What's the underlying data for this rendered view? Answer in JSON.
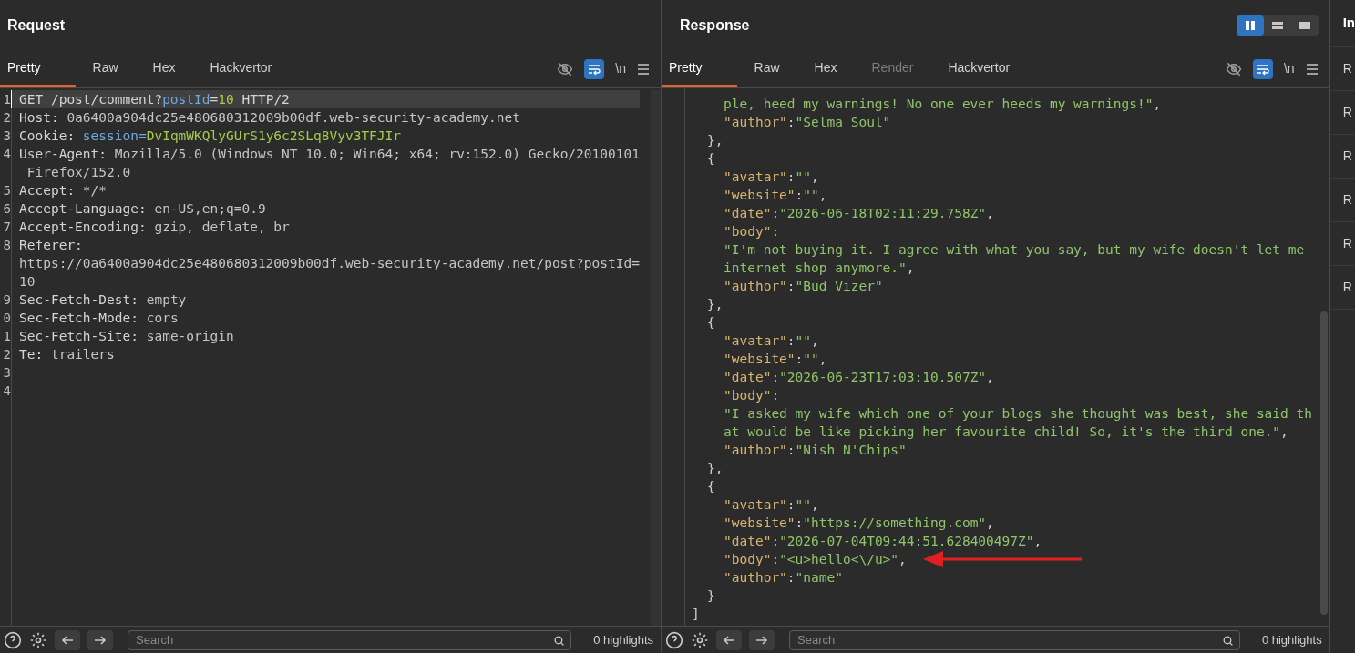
{
  "request": {
    "title": "Request",
    "tabs": [
      {
        "label": "Pretty",
        "selected": true
      },
      {
        "label": "Raw",
        "selected": false
      },
      {
        "label": "Hex",
        "selected": false
      },
      {
        "label": "Hackvertor",
        "selected": false
      }
    ],
    "toolbar": {
      "word_wrap": true,
      "newline_label": "\\n"
    },
    "lines": [
      {
        "number": "1",
        "current": true,
        "segments": [
          {
            "kind": "plain",
            "text": "GET /post/comment?"
          },
          {
            "kind": "param",
            "text": "postId"
          },
          {
            "kind": "plain",
            "text": "="
          },
          {
            "kind": "pvalue",
            "text": "10"
          },
          {
            "kind": "plain",
            "text": " HTTP/2"
          }
        ]
      },
      {
        "number": "2",
        "current": false,
        "segments": [
          {
            "kind": "name",
            "text": "Host: "
          },
          {
            "kind": "value",
            "text": "0a6400a904dc25e480680312009b00df.web-security-academy.net"
          }
        ]
      },
      {
        "number": "3",
        "current": false,
        "segments": [
          {
            "kind": "name",
            "text": "Cookie: "
          },
          {
            "kind": "param",
            "text": "session="
          },
          {
            "kind": "pvalue",
            "text": "DvIqmWKQlyGUrS1y6c2SLq8Vyv3TFJIr"
          }
        ]
      },
      {
        "number": "4",
        "current": false,
        "segments": [
          {
            "kind": "name",
            "text": "User-Agent: "
          },
          {
            "kind": "value",
            "text": "Mozilla/5.0 (Windows NT 10.0; Win64; x64; rv:152.0) Gecko/20100101"
          }
        ]
      },
      {
        "current": false,
        "segments": [
          {
            "kind": "value",
            "text": " Firefox/152.0"
          }
        ]
      },
      {
        "number": "5",
        "current": false,
        "segments": [
          {
            "kind": "name",
            "text": "Accept: "
          },
          {
            "kind": "value",
            "text": "*/*"
          }
        ]
      },
      {
        "number": "6",
        "current": false,
        "segments": [
          {
            "kind": "name",
            "text": "Accept-Language: "
          },
          {
            "kind": "value",
            "text": "en-US,en;q=0.9"
          }
        ]
      },
      {
        "number": "7",
        "current": false,
        "segments": [
          {
            "kind": "name",
            "text": "Accept-Encoding: "
          },
          {
            "kind": "value",
            "text": "gzip, deflate, br"
          }
        ]
      },
      {
        "number": "8",
        "current": false,
        "segments": [
          {
            "kind": "name",
            "text": "Referer: "
          }
        ]
      },
      {
        "current": false,
        "segments": [
          {
            "kind": "value",
            "text": "https://0a6400a904dc25e480680312009b00df.web-security-academy.net/post?postId="
          }
        ]
      },
      {
        "current": false,
        "segments": [
          {
            "kind": "value",
            "text": "10"
          }
        ]
      },
      {
        "number": "9",
        "current": false,
        "segments": [
          {
            "kind": "name",
            "text": "Sec-Fetch-Dest: "
          },
          {
            "kind": "value",
            "text": "empty"
          }
        ]
      },
      {
        "number": "0",
        "current": false,
        "segments": [
          {
            "kind": "name",
            "text": "Sec-Fetch-Mode: "
          },
          {
            "kind": "value",
            "text": "cors"
          }
        ]
      },
      {
        "number": "1",
        "current": false,
        "segments": [
          {
            "kind": "name",
            "text": "Sec-Fetch-Site: "
          },
          {
            "kind": "value",
            "text": "same-origin"
          }
        ]
      },
      {
        "number": "2",
        "current": false,
        "segments": [
          {
            "kind": "name",
            "text": "Te: "
          },
          {
            "kind": "value",
            "text": "trailers"
          }
        ]
      },
      {
        "number": "3",
        "current": false
      },
      {
        "number": "4",
        "current": false
      }
    ],
    "search": {
      "placeholder": "Search"
    },
    "highlights": "0 highlights"
  },
  "response": {
    "title": "Response",
    "layout_buttons": [
      {
        "selected": true
      },
      {
        "selected": false
      },
      {
        "selected": false
      }
    ],
    "tabs": [
      {
        "label": "Pretty",
        "selected": true,
        "disabled": false
      },
      {
        "label": "Raw",
        "selected": false,
        "disabled": false
      },
      {
        "label": "Hex",
        "selected": false,
        "disabled": false
      },
      {
        "label": "Render",
        "selected": false,
        "disabled": true
      },
      {
        "label": "Hackvertor",
        "selected": false,
        "disabled": false
      }
    ],
    "toolbar": {
      "word_wrap": true,
      "newline_label": "\\n"
    },
    "lines": [
      {
        "kind": "member",
        "segments": [
          {
            "kind": "str",
            "text": "ple, heed my warnings! No one ever heeds my warnings!\""
          },
          {
            "kind": "punct",
            "text": ","
          }
        ]
      },
      {
        "kind": "member",
        "segments": [
          {
            "kind": "key",
            "text": "\"author\""
          },
          {
            "kind": "punct",
            "text": ":"
          },
          {
            "kind": "str",
            "text": "\"Selma Soul\""
          }
        ]
      },
      {
        "kind": "object",
        "segments": [
          {
            "kind": "punct",
            "text": "},"
          }
        ]
      },
      {
        "kind": "object",
        "segments": [
          {
            "kind": "punct",
            "text": "{"
          }
        ]
      },
      {
        "kind": "member",
        "segments": [
          {
            "kind": "key",
            "text": "\"avatar\""
          },
          {
            "kind": "punct",
            "text": ":"
          },
          {
            "kind": "str",
            "text": "\"\""
          },
          {
            "kind": "punct",
            "text": ","
          }
        ]
      },
      {
        "kind": "member",
        "segments": [
          {
            "kind": "key",
            "text": "\"website\""
          },
          {
            "kind": "punct",
            "text": ":"
          },
          {
            "kind": "str",
            "text": "\"\""
          },
          {
            "kind": "punct",
            "text": ","
          }
        ]
      },
      {
        "kind": "member",
        "segments": [
          {
            "kind": "key",
            "text": "\"date\""
          },
          {
            "kind": "punct",
            "text": ":"
          },
          {
            "kind": "str",
            "text": "\"2026-06-18T02:11:29.758Z\""
          },
          {
            "kind": "punct",
            "text": ","
          }
        ]
      },
      {
        "kind": "member",
        "segments": [
          {
            "kind": "key",
            "text": "\"body\""
          },
          {
            "kind": "punct",
            "text": ":"
          }
        ]
      },
      {
        "kind": "member",
        "segments": [
          {
            "kind": "str",
            "text": "\"I'm not buying it. I agree with what you say, but my wife doesn't let me"
          }
        ]
      },
      {
        "kind": "member",
        "segments": [
          {
            "kind": "str",
            "text": "internet shop anymore.\""
          },
          {
            "kind": "punct",
            "text": ","
          }
        ]
      },
      {
        "kind": "member",
        "segments": [
          {
            "kind": "key",
            "text": "\"author\""
          },
          {
            "kind": "punct",
            "text": ":"
          },
          {
            "kind": "str",
            "text": "\"Bud Vizer\""
          }
        ]
      },
      {
        "kind": "object",
        "segments": [
          {
            "kind": "punct",
            "text": "},"
          }
        ]
      },
      {
        "kind": "object",
        "segments": [
          {
            "kind": "punct",
            "text": "{"
          }
        ]
      },
      {
        "kind": "member",
        "segments": [
          {
            "kind": "key",
            "text": "\"avatar\""
          },
          {
            "kind": "punct",
            "text": ":"
          },
          {
            "kind": "str",
            "text": "\"\""
          },
          {
            "kind": "punct",
            "text": ","
          }
        ]
      },
      {
        "kind": "member",
        "segments": [
          {
            "kind": "key",
            "text": "\"website\""
          },
          {
            "kind": "punct",
            "text": ":"
          },
          {
            "kind": "str",
            "text": "\"\""
          },
          {
            "kind": "punct",
            "text": ","
          }
        ]
      },
      {
        "kind": "member",
        "segments": [
          {
            "kind": "key",
            "text": "\"date\""
          },
          {
            "kind": "punct",
            "text": ":"
          },
          {
            "kind": "str",
            "text": "\"2026-06-23T17:03:10.507Z\""
          },
          {
            "kind": "punct",
            "text": ","
          }
        ]
      },
      {
        "kind": "member",
        "segments": [
          {
            "kind": "key",
            "text": "\"body\""
          },
          {
            "kind": "punct",
            "text": ":"
          }
        ]
      },
      {
        "kind": "member",
        "segments": [
          {
            "kind": "str",
            "text": "\"I asked my wife which one of your blogs she thought was best, she said th"
          }
        ]
      },
      {
        "kind": "member",
        "segments": [
          {
            "kind": "str",
            "text": "at would be like picking her favourite child! So, it's the third one.\""
          },
          {
            "kind": "punct",
            "text": ","
          }
        ]
      },
      {
        "kind": "member",
        "segments": [
          {
            "kind": "key",
            "text": "\"author\""
          },
          {
            "kind": "punct",
            "text": ":"
          },
          {
            "kind": "str",
            "text": "\"Nish N'Chips\""
          }
        ]
      },
      {
        "kind": "object",
        "segments": [
          {
            "kind": "punct",
            "text": "},"
          }
        ]
      },
      {
        "kind": "object",
        "segments": [
          {
            "kind": "punct",
            "text": "{"
          }
        ]
      },
      {
        "kind": "member",
        "segments": [
          {
            "kind": "key",
            "text": "\"avatar\""
          },
          {
            "kind": "punct",
            "text": ":"
          },
          {
            "kind": "str",
            "text": "\"\""
          },
          {
            "kind": "punct",
            "text": ","
          }
        ]
      },
      {
        "kind": "member",
        "segments": [
          {
            "kind": "key",
            "text": "\"website\""
          },
          {
            "kind": "punct",
            "text": ":"
          },
          {
            "kind": "str",
            "text": "\"https://something.com\""
          },
          {
            "kind": "punct",
            "text": ","
          }
        ]
      },
      {
        "kind": "member",
        "segments": [
          {
            "kind": "key",
            "text": "\"date\""
          },
          {
            "kind": "punct",
            "text": ":"
          },
          {
            "kind": "str",
            "text": "\"2026-07-04T09:44:51.628400497Z\""
          },
          {
            "kind": "punct",
            "text": ","
          }
        ]
      },
      {
        "kind": "member",
        "arrow": true,
        "segments": [
          {
            "kind": "key",
            "text": "\"body\""
          },
          {
            "kind": "punct",
            "text": ":"
          },
          {
            "kind": "str",
            "text": "\"<u>hello<\\/u>\""
          },
          {
            "kind": "punct",
            "text": ","
          }
        ]
      },
      {
        "kind": "member",
        "segments": [
          {
            "kind": "key",
            "text": "\"author\""
          },
          {
            "kind": "punct",
            "text": ":"
          },
          {
            "kind": "str",
            "text": "\"name\""
          }
        ]
      },
      {
        "kind": "object",
        "segments": [
          {
            "kind": "punct",
            "text": "}"
          }
        ]
      },
      {
        "kind": "root",
        "segments": [
          {
            "kind": "punct",
            "text": "]"
          }
        ]
      }
    ],
    "search": {
      "placeholder": "Search"
    },
    "highlights": "0 highlights"
  },
  "side_panel": {
    "title": "In",
    "items": [
      "R",
      "R",
      "R",
      "R",
      "R",
      "R"
    ]
  }
}
